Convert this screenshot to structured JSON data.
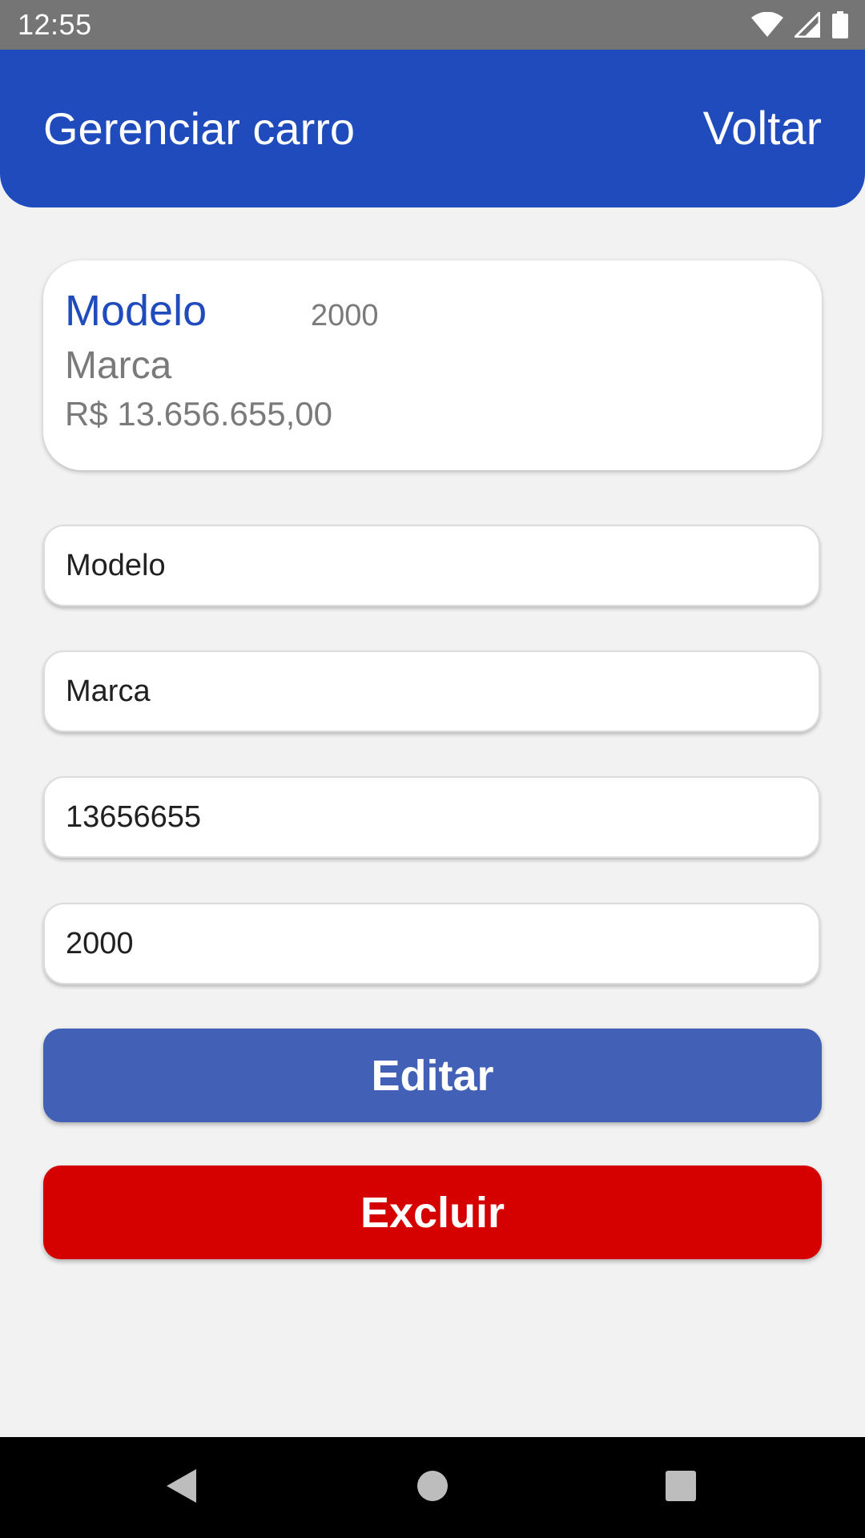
{
  "status_bar": {
    "time": "12:55",
    "icons": [
      "wifi-icon",
      "cellular-signal-icon",
      "battery-icon"
    ]
  },
  "app_bar": {
    "title": "Gerenciar carro",
    "back_label": "Voltar",
    "color": "#1f4bbd"
  },
  "car_card": {
    "model": "Modelo",
    "year": "2000",
    "brand": "Marca",
    "price": "R$ 13.656.655,00"
  },
  "form": {
    "model_value": "Modelo",
    "brand_value": "Marca",
    "price_value": "13656655",
    "year_value": "2000"
  },
  "buttons": {
    "edit_label": "Editar",
    "edit_color": "#4260b5",
    "delete_label": "Excluir",
    "delete_color": "#d50000"
  },
  "nav_bar": {
    "icons": [
      "back-triangle-icon",
      "home-circle-icon",
      "recent-apps-square-icon"
    ]
  }
}
